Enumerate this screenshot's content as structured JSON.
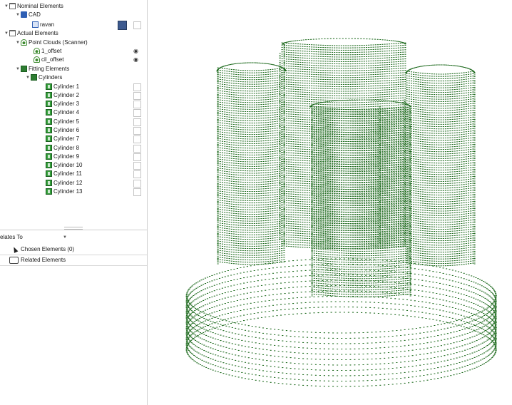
{
  "tree": {
    "nominal_label": "Nominal Elements",
    "cad_label": "CAD",
    "ravan_label": "ravan",
    "actual_label": "Actual Elements",
    "pointclouds_label": "Point Clouds (Scanner)",
    "offset1_label": "1_offset",
    "ciloffset_label": "cil_offset",
    "fitting_label": "Fitting Elements",
    "cylinders_label": "Cylinders",
    "cylinder_items": [
      "Cylinder 1",
      "Cylinder 2",
      "Cylinder 3",
      "Cylinder 4",
      "Cylinder 5",
      "Cylinder 6",
      "Cylinder 7",
      "Cylinder 8",
      "Cylinder 9",
      "Cylinder 10",
      "Cylinder 11",
      "Cylinder 12",
      "Cylinder 13"
    ]
  },
  "relates": {
    "dropdown_label": "elates To",
    "chosen_label": "Chosen Elements (0)",
    "related_label": "Related Elements"
  },
  "colors": {
    "points": "#1f6b1f",
    "cad_swatch": "#3d5a8f"
  },
  "icons": {
    "eye": "eye-icon",
    "folder": "folder-icon"
  }
}
